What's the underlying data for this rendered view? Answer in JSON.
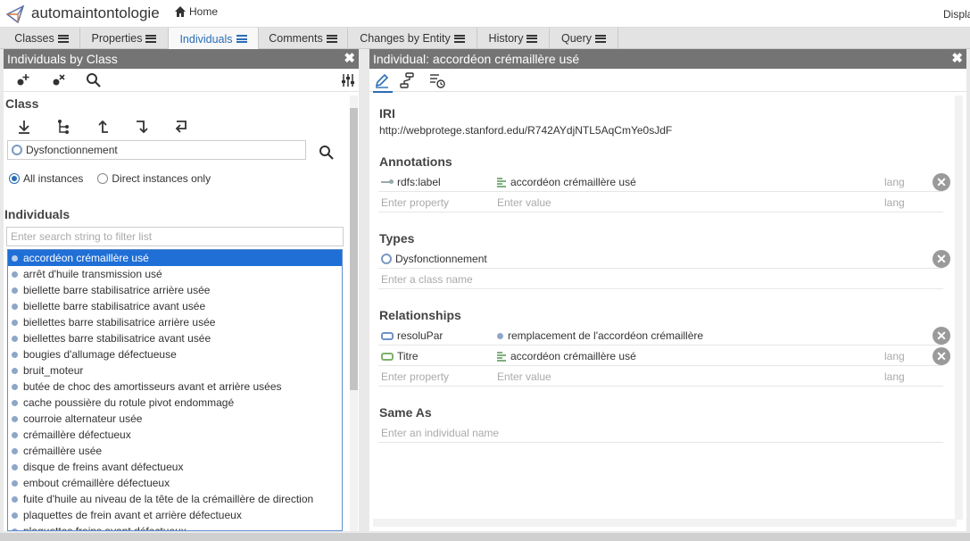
{
  "app": {
    "title": "automaintontologie",
    "home_label": "Home",
    "display_label": "Displa"
  },
  "tabs": [
    {
      "label": "Classes"
    },
    {
      "label": "Properties"
    },
    {
      "label": "Individuals"
    },
    {
      "label": "Comments"
    },
    {
      "label": "Changes by Entity"
    },
    {
      "label": "History"
    },
    {
      "label": "Query"
    }
  ],
  "active_tab": "Individuals",
  "left": {
    "title": "Individuals by Class",
    "close": "✖",
    "class_label": "Class",
    "class_value": "Dysfonctionnement",
    "radio_all": "All instances",
    "radio_direct": "Direct instances only",
    "individuals_label": "Individuals",
    "filter_placeholder": "Enter search string to filter list",
    "items": [
      "accordéon crémaillère usé",
      "arrêt d'huile transmission usé",
      "biellette barre stabilisatrice arrière usée",
      "biellette barre stabilisatrice avant usée",
      "biellettes barre stabilisatrice arrière usée",
      "biellettes barre stabilisatrice avant usée",
      "bougies d'allumage défectueuse",
      "bruit_moteur",
      "butée de choc des amortisseurs avant et arrière usées",
      "cache poussière du rotule pivot endommagé",
      "courroie alternateur usée",
      "crémaillère défectueux",
      "crémaillère usée",
      "disque de freins avant défectueux",
      "embout crémaillère défectueux",
      "fuite d'huile au niveau de la tête de la crémaillère de direction",
      "plaquettes de frein avant et arrière défectueux",
      "plaquettes freins avant défectueux"
    ]
  },
  "right": {
    "title": "Individual: accordéon crémaillère usé",
    "close": "✖",
    "iri_label": "IRI",
    "iri_value": "http://webprotege.stanford.edu/R742AYdjNTL5AqCmYe0sJdF",
    "annotations_label": "Annotations",
    "annotation_property": "rdfs:label",
    "annotation_value": "accordéon crémaillère usé",
    "lang_placeholder": "lang",
    "enter_property": "Enter property",
    "enter_value": "Enter value",
    "types_label": "Types",
    "type_value": "Dysfonctionnement",
    "enter_class": "Enter a class name",
    "relationships_label": "Relationships",
    "rel1_property": "resoluPar",
    "rel1_value": "remplacement de l'accordéon crémaillère",
    "rel2_property": "Titre",
    "rel2_value": "accordéon crémaillère usé",
    "same_as_label": "Same As",
    "enter_individual": "Enter an individual name",
    "delete_glyph": "✕"
  },
  "colors": {
    "accent": "#2a6db5",
    "selection": "#1f6fd6",
    "panel_header": "#747474"
  }
}
